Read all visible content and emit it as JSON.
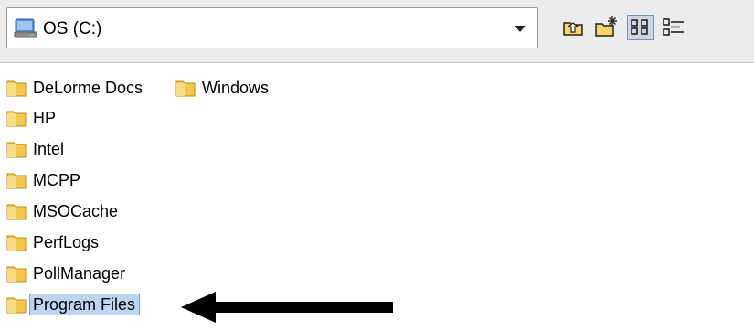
{
  "toolbar": {
    "location_label": "OS (C:)",
    "icons": {
      "drive": "drive-icon",
      "dropdown": "chevron-down-icon",
      "up": "up-folder-icon",
      "new_folder": "new-folder-icon",
      "list_view": "list-view-icon",
      "details_view": "details-view-icon"
    },
    "active_view": "list"
  },
  "folders": [
    {
      "label": "DeLorme Docs",
      "selected": false
    },
    {
      "label": "Windows",
      "selected": false
    },
    {
      "label": "HP",
      "selected": false
    },
    {
      "label": "Intel",
      "selected": false
    },
    {
      "label": "MCPP",
      "selected": false
    },
    {
      "label": "MSOCache",
      "selected": false
    },
    {
      "label": "PerfLogs",
      "selected": false
    },
    {
      "label": "PollManager",
      "selected": false
    },
    {
      "label": "Program Files",
      "selected": true
    }
  ],
  "annotation": {
    "type": "arrow",
    "points_to": "Program Files",
    "color": "#000000"
  },
  "colors": {
    "folder": "#f2c94c",
    "selection": "#bfd3f2",
    "toolbar": "#ececec"
  }
}
